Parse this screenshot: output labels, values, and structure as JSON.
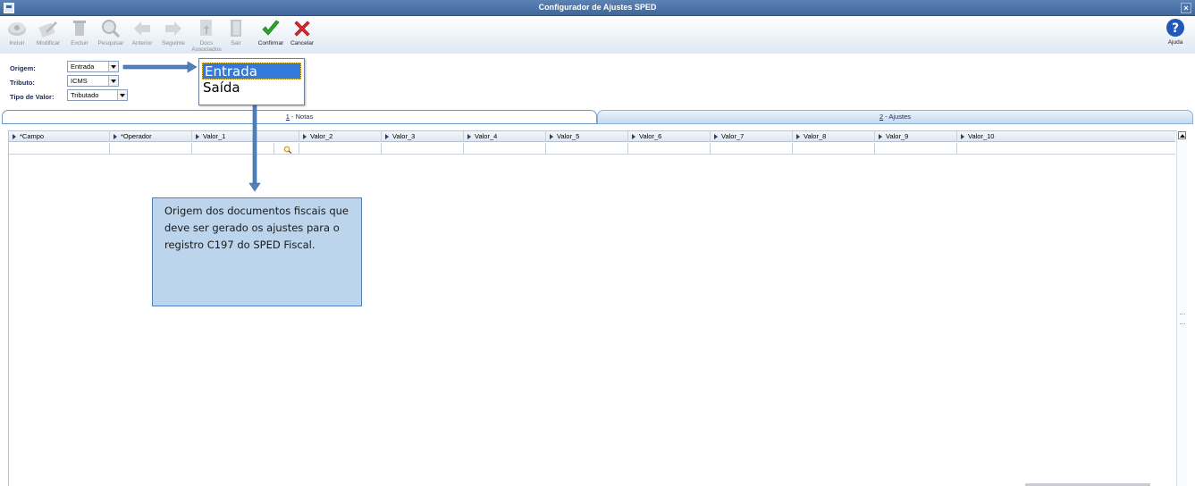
{
  "window": {
    "title": "Configurador de Ajustes SPED"
  },
  "toolbar": {
    "buttons": [
      {
        "label": "Incluir",
        "icon": "add-icon",
        "enabled": false
      },
      {
        "label": "Modificar",
        "icon": "edit-icon",
        "enabled": false
      },
      {
        "label": "Excluir",
        "icon": "delete-icon",
        "enabled": false
      },
      {
        "label": "Pesquisar",
        "icon": "search-icon",
        "enabled": false
      },
      {
        "label": "Anterior",
        "icon": "arrow-left-icon",
        "enabled": false
      },
      {
        "label": "Seguinte",
        "icon": "arrow-right-icon",
        "enabled": false
      },
      {
        "label": "Docs Associados",
        "icon": "docs-icon",
        "enabled": false
      },
      {
        "label": "Sair",
        "icon": "exit-icon",
        "enabled": false
      },
      {
        "label": "Confirmar",
        "icon": "check-icon",
        "enabled": true
      },
      {
        "label": "Cancelar",
        "icon": "cancel-icon",
        "enabled": true
      }
    ],
    "help": {
      "label": "Ajuda",
      "icon": "help-icon"
    }
  },
  "filters": {
    "origem": {
      "label": "Origem:",
      "value": "Entrada"
    },
    "tributo": {
      "label": "Tributo:",
      "value": "ICMS"
    },
    "tipo_valor": {
      "label": "Tipo de Valor:",
      "value": "Tributado"
    }
  },
  "dropdown": {
    "options": [
      "Entrada",
      "Saída"
    ],
    "selected": "Entrada"
  },
  "tabs": [
    {
      "number": "1",
      "label": " - Notas",
      "active": true
    },
    {
      "number": "2",
      "label": " - Ajustes",
      "active": false
    }
  ],
  "grid": {
    "columns": [
      "*Campo",
      "*Operador",
      "Valor_1",
      "Valor_2",
      "Valor_3",
      "Valor_4",
      "Valor_5",
      "Valor_6",
      "Valor_7",
      "Valor_8",
      "Valor_9",
      "Valor_10"
    ]
  },
  "annotation": {
    "text": "Origem dos documentos fiscais que deve ser gerado os ajustes para o registro C197 do SPED Fiscal."
  },
  "colors": {
    "titlebar": "#4a72a8",
    "selection": "#3379d8",
    "callout_fill": "#bcd4ec",
    "callout_border": "#4f81bd",
    "arrow": "#4f81bd"
  }
}
